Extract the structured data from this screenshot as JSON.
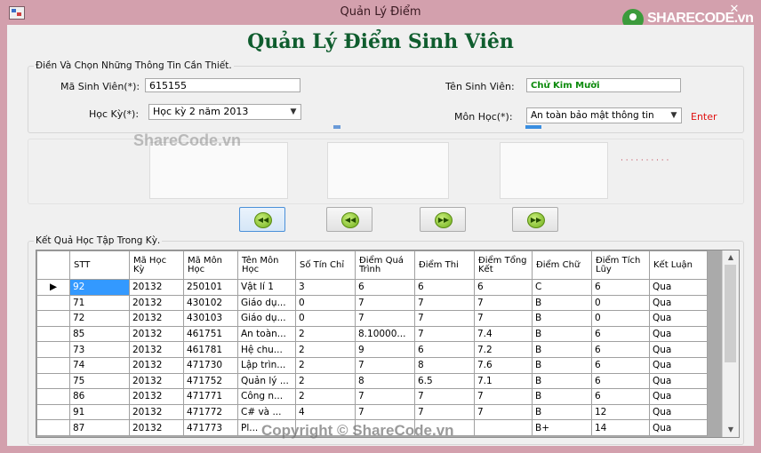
{
  "window": {
    "title": "Quản Lý Điểm",
    "logo_text": "SHARECODE.vn",
    "close_icon": "close-icon"
  },
  "heading": "Quản Lý Điểm Sinh Viên",
  "input_group": {
    "label": "Điền Và Chọn Những Thông Tin Cần Thiết.",
    "student_id_label": "Mã Sinh Viên(*):",
    "student_id_value": "615155",
    "student_name_label": "Tên Sinh Viên:",
    "student_name_value": "Chử Kim Mười",
    "semester_label": "Học Kỳ(*):",
    "semester_value": "Học kỳ 2 năm 2013",
    "subject_label": "Môn Học(*):",
    "subject_value": "An toàn bảo mật thông tin",
    "enter_label": "Enter"
  },
  "watermarks": {
    "top": "ShareCode.vn",
    "bottom": "Copyright © ShareCode.vn"
  },
  "nav_buttons": [
    {
      "name": "first-record-button",
      "icon": "double-left-arrow-icon",
      "glyph": "◀◀"
    },
    {
      "name": "previous-record-button",
      "icon": "double-left-arrow-icon",
      "glyph": "◀◀"
    },
    {
      "name": "next-record-button",
      "icon": "double-right-arrow-icon",
      "glyph": "▶▶"
    },
    {
      "name": "last-record-button",
      "icon": "double-right-arrow-icon",
      "glyph": "▶▶"
    }
  ],
  "results": {
    "label": "Kết Quả Học Tập Trong Kỳ.",
    "columns": [
      "STT",
      "Mã Học Kỳ",
      "Mã Môn Học",
      "Tên Môn Học",
      "Số Tín Chỉ",
      "Điểm Quá Trình",
      "Điểm Thi",
      "Điểm Tổng Kết",
      "Điểm Chữ",
      "Điểm Tích Lũy",
      "Kết Luận"
    ],
    "rows": [
      [
        "92",
        "20132",
        "250101",
        "Vật lí 1",
        "3",
        "6",
        "6",
        "6",
        "C",
        "6",
        "Qua"
      ],
      [
        "71",
        "20132",
        "430102",
        "Giáo dụ...",
        "0",
        "7",
        "7",
        "7",
        "B",
        "0",
        "Qua"
      ],
      [
        "72",
        "20132",
        "430103",
        "Giáo dụ...",
        "0",
        "7",
        "7",
        "7",
        "B",
        "0",
        "Qua"
      ],
      [
        "85",
        "20132",
        "461751",
        "An toàn...",
        "2",
        "8.10000...",
        "7",
        "7.4",
        "B",
        "6",
        "Qua"
      ],
      [
        "73",
        "20132",
        "461781",
        "Hệ chu...",
        "2",
        "9",
        "6",
        "7.2",
        "B",
        "6",
        "Qua"
      ],
      [
        "74",
        "20132",
        "471730",
        "Lập trìn...",
        "2",
        "7",
        "8",
        "7.6",
        "B",
        "6",
        "Qua"
      ],
      [
        "75",
        "20132",
        "471752",
        "Quản lý ...",
        "2",
        "8",
        "6.5",
        "7.1",
        "B",
        "6",
        "Qua"
      ],
      [
        "86",
        "20132",
        "471771",
        "Công n...",
        "2",
        "7",
        "7",
        "7",
        "B",
        "6",
        "Qua"
      ],
      [
        "91",
        "20132",
        "471772",
        "C# và ...",
        "4",
        "7",
        "7",
        "7",
        "B",
        "12",
        "Qua"
      ],
      [
        "87",
        "20132",
        "471773",
        "Pl...",
        "",
        "",
        "",
        "",
        "B+",
        "14",
        "Qua"
      ]
    ]
  }
}
